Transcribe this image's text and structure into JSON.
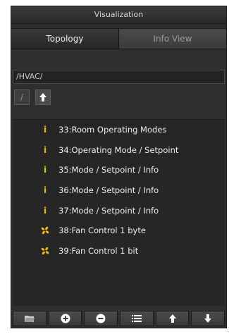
{
  "title": "Visualization",
  "tabs": {
    "topology": "Topology",
    "info_view": "Info View"
  },
  "path": "/HVAC/",
  "nav": {
    "root_label": "/"
  },
  "items": [
    {
      "label": "33:Room Operating Modes",
      "icon": "info-icon"
    },
    {
      "label": "34:Operating Mode / Setpoint",
      "icon": "info-icon"
    },
    {
      "label": "35:Mode / Setpoint / Info",
      "icon": "info-icon"
    },
    {
      "label": "36:Mode / Setpoint / Info",
      "icon": "info-icon"
    },
    {
      "label": "37:Mode / Setpoint / Info",
      "icon": "info-icon"
    },
    {
      "label": "38:Fan Control 1 byte",
      "icon": "fan-icon"
    },
    {
      "label": "39:Fan Control 1 bit",
      "icon": "fan-icon"
    }
  ],
  "colors": {
    "accent_icon": "#f2c200",
    "panel_bg": "#2f2f2f",
    "list_bg": "#262626"
  }
}
